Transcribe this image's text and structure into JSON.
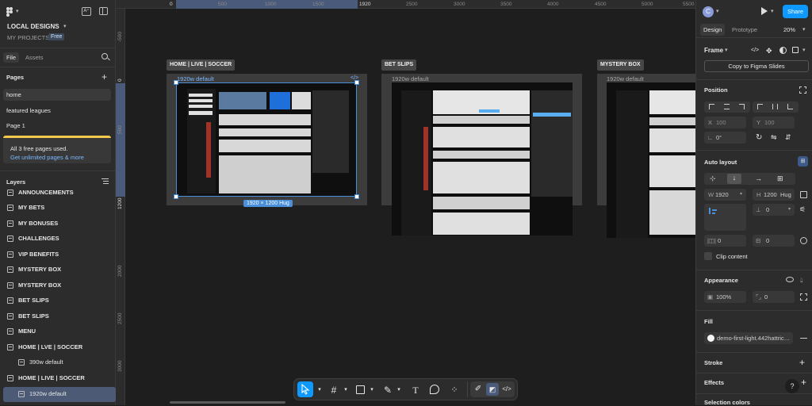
{
  "left_panel": {
    "project_name": "LOCAL DESIGNS",
    "team": "MY PROJECTS",
    "plan_badge": "Free",
    "tabs": [
      "File",
      "Assets"
    ],
    "pages_title": "Pages",
    "pages": [
      "home",
      "featured leagues",
      "Page 1"
    ],
    "notice_line1": "All 3 free pages used.",
    "notice_link": "Get unlimited pages & more",
    "layers_title": "Layers",
    "layers": [
      {
        "label": "ANNOUNCEMENTS"
      },
      {
        "label": "MY BETS"
      },
      {
        "label": "MY BONUSES"
      },
      {
        "label": "CHALLENGES"
      },
      {
        "label": "VIP BENEFITS"
      },
      {
        "label": "MYSTERY BOX"
      },
      {
        "label": "MYSTERY BOX"
      },
      {
        "label": "BET SLIPS"
      },
      {
        "label": "BET SLIPS"
      },
      {
        "label": "MENU"
      },
      {
        "label": "HOME | LVE | SOCCER"
      },
      {
        "label": "390w default"
      },
      {
        "label": "HOME | LIVE | SOCCER"
      },
      {
        "label": "1920w default"
      }
    ]
  },
  "ruler": {
    "top": [
      "0",
      "500",
      "1000",
      "1500",
      "1920",
      "2500",
      "3000",
      "3500",
      "4000",
      "4500",
      "5000",
      "5500"
    ],
    "left": [
      "-500",
      "0",
      "500",
      "1200",
      "2000",
      "2500",
      "3000"
    ]
  },
  "canvas": {
    "frames": [
      {
        "label": "HOME | LIVE | SOCCER",
        "sub": "1920w default",
        "size_badge": "1920 × 1200 Hug"
      },
      {
        "label": "BET SLIPS",
        "sub": "1920w default"
      },
      {
        "label": "MYSTERY BOX",
        "sub": "1920w default"
      }
    ],
    "code_glyph": "</>"
  },
  "right_panel": {
    "avatar": "C",
    "share": "Share",
    "tabs": [
      "Design",
      "Prototype"
    ],
    "zoom": "20%",
    "frame_label": "Frame",
    "copy_slides": "Copy to Figma Slides",
    "position_title": "Position",
    "x_label": "X",
    "x_val": "100",
    "y_label": "Y",
    "y_val": "100",
    "rotation": "0°",
    "auto_layout_title": "Auto layout",
    "w_label": "W",
    "w_val": "1920",
    "h_label": "H",
    "h_val": "1200",
    "h_mode": "Hug",
    "gap_val": "0",
    "pad_h": "0",
    "pad_v": "0",
    "clip_content": "Clip content",
    "appearance_title": "Appearance",
    "opacity": "100%",
    "radius": "0",
    "fill_title": "Fill",
    "fill_name": "demo-first-light.442hattric…",
    "stroke_title": "Stroke",
    "effects_title": "Effects",
    "selection_colors_title": "Selection colors",
    "help": "?"
  },
  "colors": {
    "accent": "#0d99ff",
    "selection": "#4a8fd9",
    "panel": "#2c2c2c",
    "canvas": "#1e1e1e",
    "notice": "#f2c94c"
  }
}
